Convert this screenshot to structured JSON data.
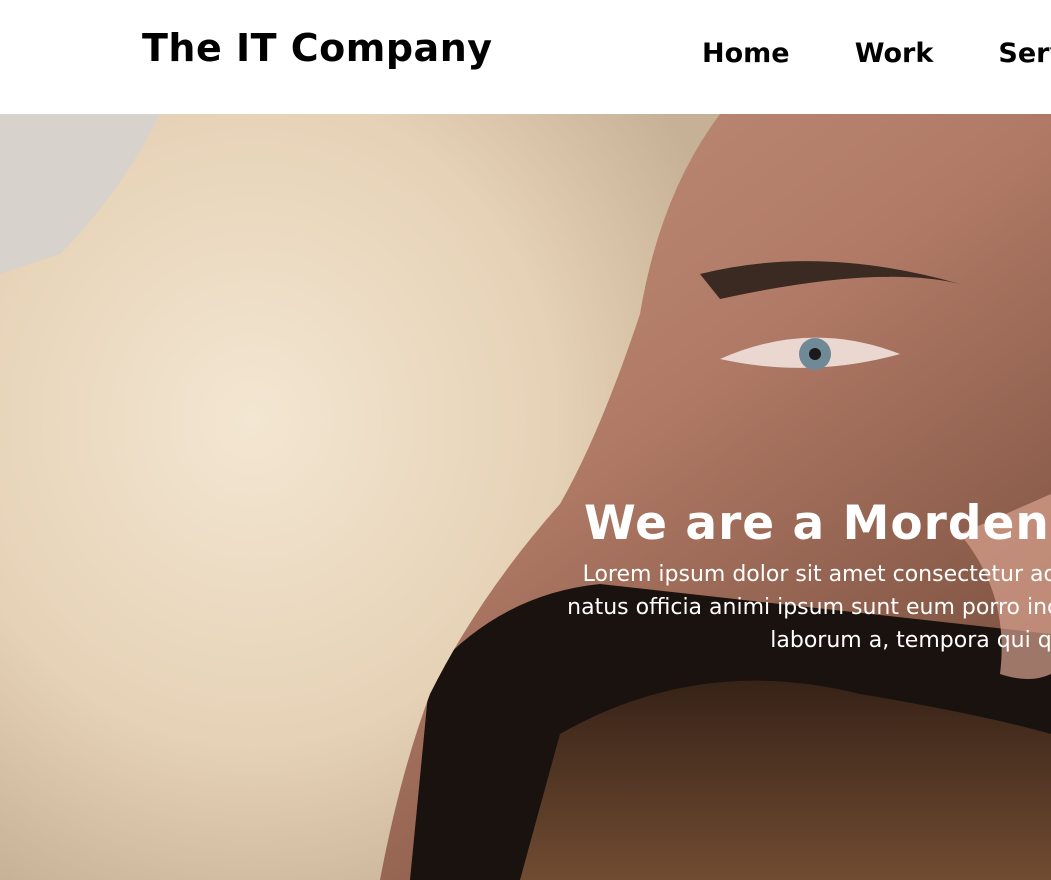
{
  "header": {
    "logo": "The IT Company",
    "nav": [
      {
        "label": "Home"
      },
      {
        "label": "Work"
      },
      {
        "label": "Servic"
      }
    ]
  },
  "hero": {
    "title": "We are a Morden I",
    "lines": [
      "Lorem ipsum dolor sit amet consectetur adipisici",
      "natus officia animi ipsum sunt eum porro incidunt c",
      "laborum a, tempora qui q"
    ],
    "image": "portrait-photo"
  }
}
